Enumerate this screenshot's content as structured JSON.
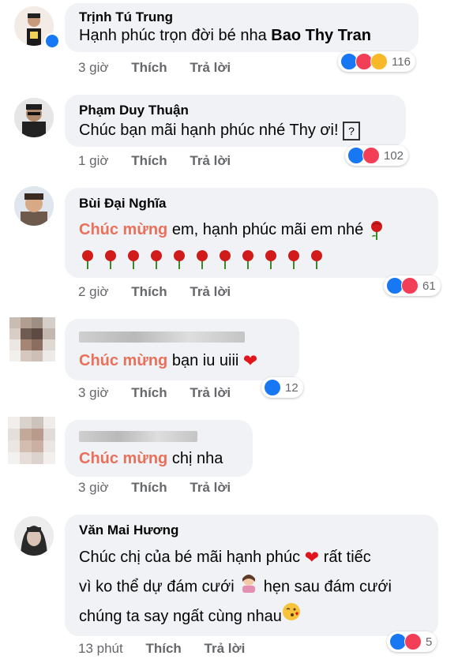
{
  "comments": [
    {
      "author": "Trịnh Tú Trung",
      "text_before": "Hạnh phúc trọn đời bé nha ",
      "mention": "Bao Thy Tran",
      "time": "3 giờ",
      "like_label": "Thích",
      "reply_label": "Trả lời",
      "reaction_count": "116",
      "reactions": [
        "like-icon",
        "love-icon",
        "haha-icon"
      ]
    },
    {
      "author": "Phạm Duy Thuận",
      "text": "Chúc bạn mãi hạnh phúc nhé Thy ơi!",
      "time": "1 giờ",
      "like_label": "Thích",
      "reply_label": "Trả lời",
      "reaction_count": "102",
      "reactions": [
        "like-icon",
        "love-icon"
      ]
    },
    {
      "author": "Bùi Đại Nghĩa",
      "highlight": "Chúc mừng",
      "text_after": " em, hạnh phúc mãi em nhé",
      "time": "2 giờ",
      "like_label": "Thích",
      "reply_label": "Trả lời",
      "reaction_count": "61",
      "reactions": [
        "like-icon",
        "love-icon"
      ]
    },
    {
      "author": "",
      "highlight": "Chúc mừng",
      "text_after": " bạn iu uiii",
      "time": "3 giờ",
      "like_label": "Thích",
      "reply_label": "Trả lời",
      "reaction_count": "12",
      "reactions": [
        "like-icon"
      ]
    },
    {
      "author": "",
      "highlight": "Chúc mừng",
      "text_after": " chị nha",
      "time": "3 giờ",
      "like_label": "Thích",
      "reply_label": "Trả lời"
    },
    {
      "author": "Văn Mai Hương",
      "line1": "Chúc chị của bé mãi hạnh phúc",
      "line1_after": " rất tiếc",
      "line2": "vì ko thể dự đám cưới",
      "line2_after": " hẹn sau đám cưới",
      "line3": "chúng ta say ngất cùng nhau",
      "time": "13 phút",
      "like_label": "Thích",
      "reply_label": "Trả lời",
      "reaction_count": "5",
      "reactions": [
        "like-icon",
        "love-icon"
      ]
    }
  ]
}
